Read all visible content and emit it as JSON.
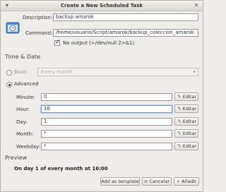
{
  "window": {
    "title": "Create a New Scheduled Task"
  },
  "task": {
    "description_label": "Description:",
    "description_value": "backup amarok",
    "command_label": "Command:",
    "command_value": "/home/usuario/Script/amarok/backup_coleccion_amarok",
    "no_output_label": "No output (>/dev/null 2>&1)"
  },
  "time_date": {
    "section_title": "Time & Date",
    "basic_label": "Basic",
    "basic_combo_value": "Every month",
    "advanced_label": "Advanced",
    "rows": [
      {
        "label": "Minute:",
        "value": "0",
        "edit_label": "Editar"
      },
      {
        "label": "Hour:",
        "value": "16",
        "edit_label": "Editar"
      },
      {
        "label": "Day:",
        "value": "1",
        "edit_label": "Editar"
      },
      {
        "label": "Month:",
        "value": "*",
        "edit_label": "Editar"
      },
      {
        "label": "Weekday:",
        "value": "*",
        "edit_label": "Editar"
      }
    ]
  },
  "preview": {
    "section_title": "Preview",
    "text": "On day 1 of every month at 16:00"
  },
  "buttons": {
    "add_template": "Add as template",
    "cancel": "Cancelar",
    "add": "Añadir"
  }
}
